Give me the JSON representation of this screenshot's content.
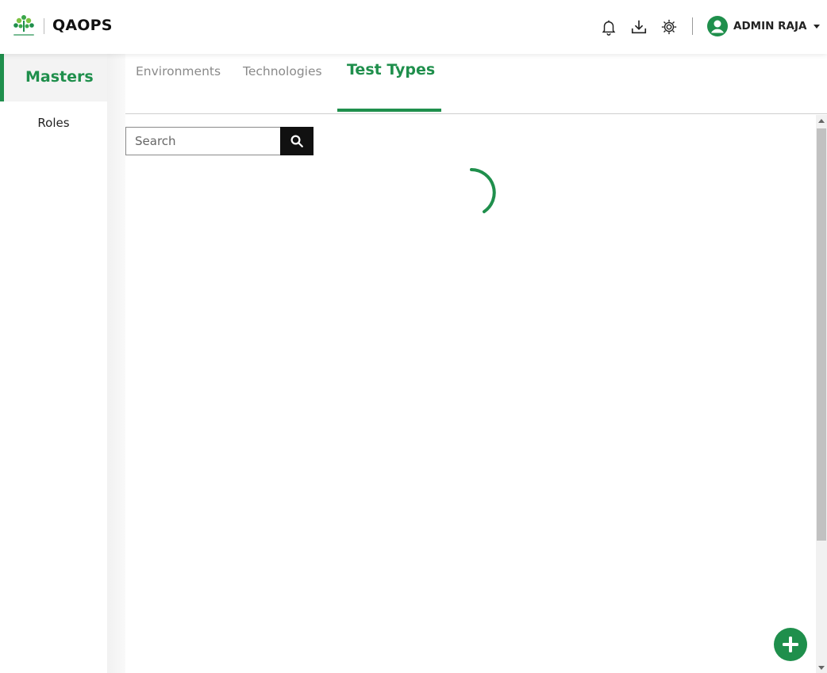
{
  "header": {
    "app_title": "QAOPS",
    "logo_icon": "walkingtree-logo-icon",
    "icons": [
      "bell-icon",
      "download-icon",
      "settings-gear-icon"
    ],
    "user": {
      "name": "ADMIN RAJA",
      "avatar_icon": "user-circle-icon"
    }
  },
  "sidebar": {
    "items": [
      {
        "label": "Masters",
        "active": true
      },
      {
        "label": "Roles",
        "active": false
      }
    ]
  },
  "tabs": [
    {
      "label": "Environments",
      "active": false
    },
    {
      "label": "Technologies",
      "active": false
    },
    {
      "label": "Test Types",
      "active": true
    }
  ],
  "search": {
    "placeholder": "Search",
    "value": "",
    "button_icon": "search-icon"
  },
  "status": {
    "loading": true,
    "spinner_icon": "loading-spinner-icon"
  },
  "fab": {
    "icon": "plus-icon"
  },
  "colors": {
    "accent": "#1f8f4c",
    "text": "#222222",
    "muted": "#8a8a8a"
  }
}
